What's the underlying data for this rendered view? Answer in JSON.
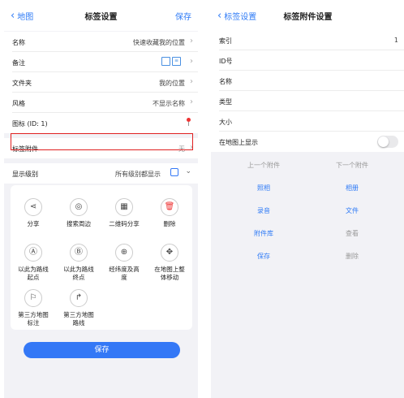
{
  "left": {
    "nav": {
      "back_label": "地图",
      "title": "标签设置",
      "save_label": "保存"
    },
    "rows": [
      {
        "label": "名称",
        "value": "快速收藏我的位置"
      },
      {
        "label": "备注",
        "value": ""
      },
      {
        "label": "文件夹",
        "value": "我的位置"
      },
      {
        "label": "风格",
        "value": "不显示名称"
      },
      {
        "label": "图标 (ID: 1)",
        "value": ""
      },
      {
        "label": "标签附件",
        "value": "无"
      },
      {
        "label": "显示级别",
        "value": "所有级别都显示"
      }
    ],
    "actions": [
      {
        "label": "分享",
        "icon": "share-icon"
      },
      {
        "label": "搜索周边",
        "icon": "nearby-icon"
      },
      {
        "label": "二维码分享",
        "icon": "qrcode-icon"
      },
      {
        "label": "删除",
        "icon": "trash-icon"
      },
      {
        "label": "以此为路线起点",
        "icon": "route-start-icon"
      },
      {
        "label": "以此为路线终点",
        "icon": "route-end-icon"
      },
      {
        "label": "经纬度及高度",
        "icon": "globe-icon"
      },
      {
        "label": "在地图上整体移动",
        "icon": "move-icon"
      },
      {
        "label": "第三方地图标注",
        "icon": "third-party-mark-icon"
      },
      {
        "label": "第三方地图路线",
        "icon": "third-party-route-icon"
      }
    ],
    "save_button": "保存",
    "colors": {
      "accent": "#3478f6",
      "highlight": "#e02020",
      "delete": "#e33333"
    }
  },
  "right": {
    "nav": {
      "back_label": "标签设置",
      "title": "标签附件设置"
    },
    "rows": [
      {
        "label": "索引",
        "value": "1"
      },
      {
        "label": "ID号",
        "value": ""
      },
      {
        "label": "名称",
        "value": ""
      },
      {
        "label": "类型",
        "value": ""
      },
      {
        "label": "大小",
        "value": ""
      },
      {
        "label": "在地图上显示",
        "value": ""
      }
    ],
    "prev_label": "上一个附件",
    "next_label": "下一个附件",
    "actions_left": [
      "照相",
      "录音",
      "附件库",
      "保存"
    ],
    "actions_right": [
      "相册",
      "文件",
      "查看",
      "删除"
    ]
  }
}
